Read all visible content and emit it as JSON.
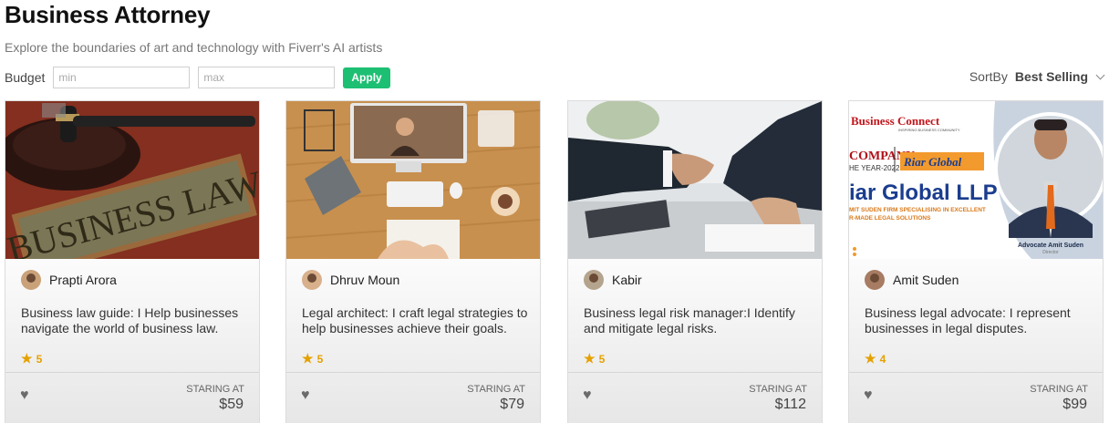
{
  "header": {
    "title": "Business Attorney",
    "subtitle": "Explore the boundaries of art and technology with Fiverr's AI artists"
  },
  "filters": {
    "budget_label": "Budget",
    "min_placeholder": "min",
    "max_placeholder": "max",
    "apply_label": "Apply",
    "sort_label": "SortBy",
    "sort_value": "Best Selling"
  },
  "cards": [
    {
      "user": "Prapti Arora",
      "description": "Business law guide: I Help businesses navigate the world of business law.",
      "rating": "5",
      "starting_label": "STARING AT",
      "price": "$59",
      "image_text": "BUSINESS LAW"
    },
    {
      "user": "Dhruv Moun",
      "description": "Legal architect: I craft legal strategies to help businesses achieve their goals.",
      "rating": "5",
      "starting_label": "STARING AT",
      "price": "$79"
    },
    {
      "user": "Kabir",
      "description": "Business legal risk manager:I Identify and mitigate legal risks.",
      "rating": "5",
      "starting_label": "STARING AT",
      "price": "$112"
    },
    {
      "user": "Amit Suden",
      "description": "Business legal advocate: I represent businesses in legal disputes.",
      "rating": "4",
      "starting_label": "STARING AT",
      "price": "$99",
      "image": {
        "brand": "Business Connect",
        "tagline": "INSPIRING BUSINESS COMMUNITY",
        "company": "COMPANY",
        "year": "HE YEAR-2022",
        "logo": "Riar Global",
        "headline": "iar Global LLP",
        "line1": "MIT SUDEN FIRM SPECIALISING IN EXCELLENT",
        "line2": "R-MADE LEGAL SOLUTIONS",
        "caption": "Advocate Amit Suden",
        "role": "Director"
      }
    }
  ],
  "colors": {
    "accent": "#1dbf73",
    "star": "#e5a100"
  }
}
